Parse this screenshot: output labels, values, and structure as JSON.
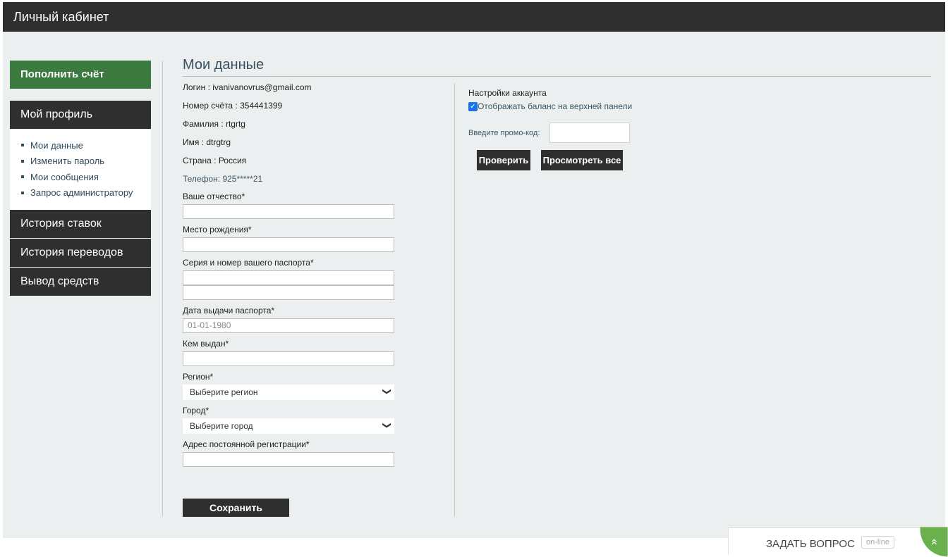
{
  "header": {
    "title": "Личный кабинет"
  },
  "sidebar": {
    "topup_label": "Пополнить счёт",
    "profile_label": "Мой профиль",
    "profile_items": [
      {
        "label": "Мои данные"
      },
      {
        "label": "Изменить пароль"
      },
      {
        "label": "Мои сообщения"
      },
      {
        "label": "Запрос администратору"
      }
    ],
    "bets_history": "История ставок",
    "transfers_history": "История переводов",
    "withdraw": "Вывод средств"
  },
  "main": {
    "heading": "Мои данные",
    "info": {
      "login": "Логин : ivanivanovrus@gmail.com",
      "account": "Номер счёта : 354441399",
      "surname": "Фамилия : rtgrtg",
      "name": "Имя : dtrgtrg",
      "country": "Страна : Россия",
      "phone": "Телефон: 925*****21"
    },
    "form": {
      "patronymic_label": "Ваше отчество*",
      "patronymic_value": "",
      "birthplace_label": "Место рождения*",
      "birthplace_value": "",
      "passport_label": "Серия и номер вашего паспорта*",
      "passport_series_value": "",
      "passport_number_value": "",
      "issue_date_label": "Дата выдачи паспорта*",
      "issue_date_placeholder": "01-01-1980",
      "issued_by_label": "Кем выдан*",
      "issued_by_value": "",
      "region_label": "Регион*",
      "region_selected": "Выберите регион",
      "city_label": "Город*",
      "city_selected": "Выберите город",
      "address_label": "Адрес постоянной регистрации*",
      "address_value": ""
    },
    "save_label": "Сохранить"
  },
  "settings": {
    "title": "Настройки аккаунта",
    "show_balance_label": "Отображать баланс на верхней панели",
    "show_balance_checked": true,
    "promo_label": "Введите промо-код:",
    "promo_value": "",
    "check_button": "Проверить",
    "view_all_button": "Просмотреть все"
  },
  "chat": {
    "label": "ЗАДАТЬ ВОПРОС",
    "badge": "on-line",
    "icon": "chevron-up-double-icon"
  },
  "colors": {
    "dark": "#2f2f2f",
    "green": "#3d7a3f",
    "background": "#eceff0",
    "chat_green": "#6ab04c"
  }
}
